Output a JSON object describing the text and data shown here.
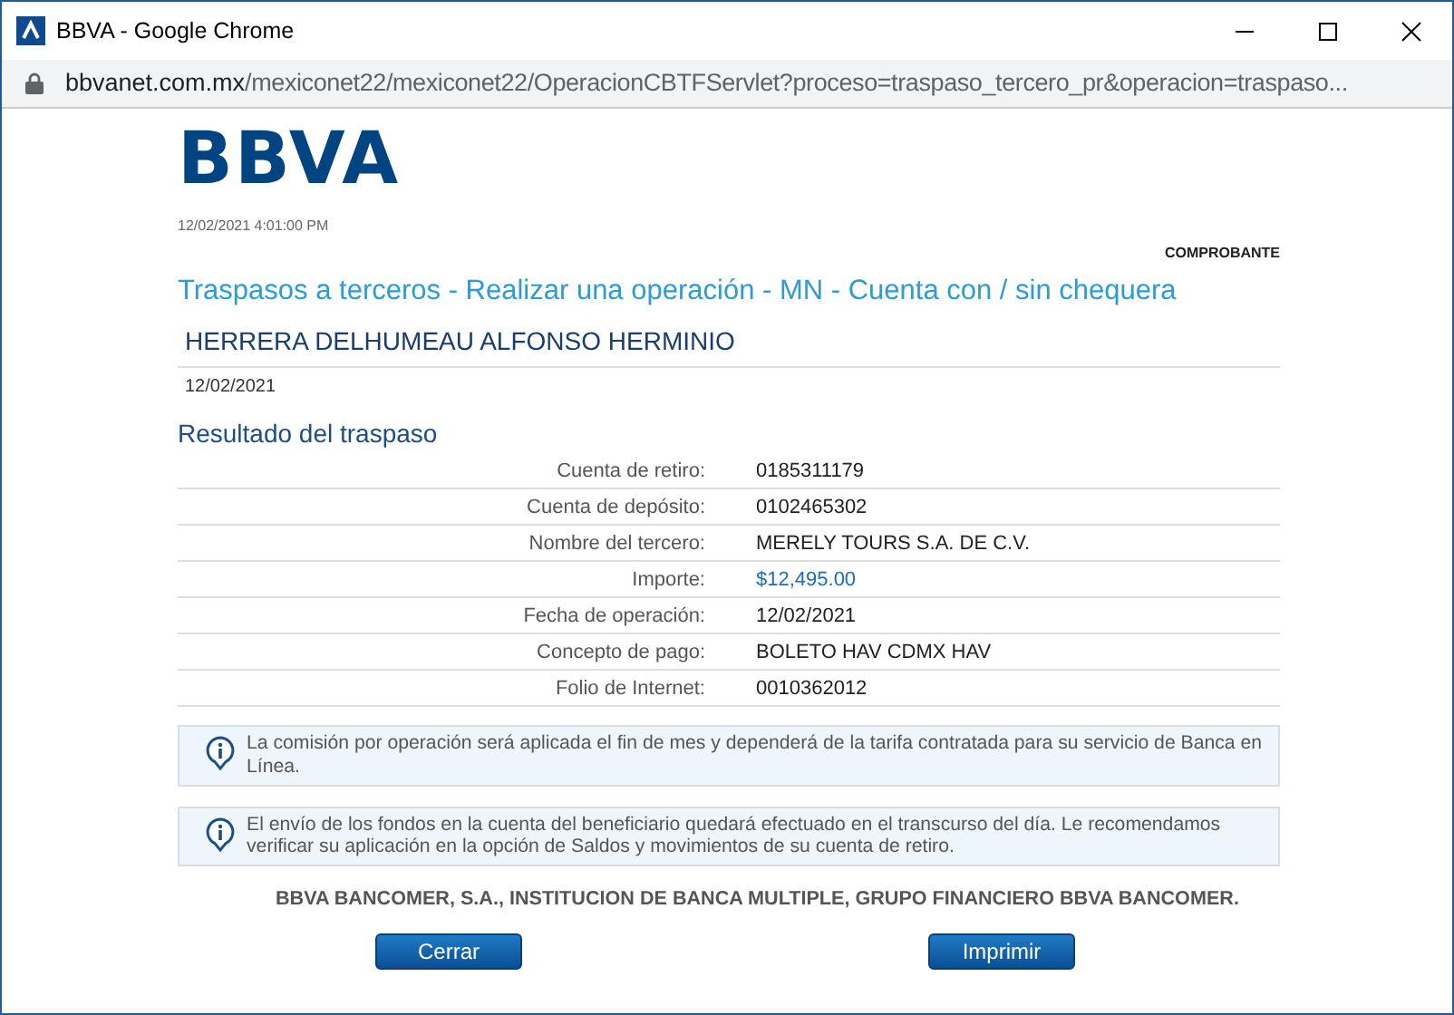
{
  "window": {
    "title": "BBVA - Google Chrome"
  },
  "address_bar": {
    "host": "bbvanet.com.mx",
    "path": "/mexiconet22/mexiconet22/OperacionCBTFServlet?proceso=traspaso_tercero_pr&operacion=traspaso..."
  },
  "logo": "BBVA",
  "timestamp": "12/02/2021 4:01:00 PM",
  "receipt_label": "COMPROBANTE",
  "page_title": "Traspasos a terceros - Realizar una operación - MN - Cuenta con / sin chequera",
  "client_name": "HERRERA DELHUMEAU ALFONSO HERMINIO",
  "date": "12/02/2021",
  "section_title": "Resultado del traspaso",
  "details": [
    {
      "label": "Cuenta de retiro:",
      "value": "0185311179",
      "kind": "plain"
    },
    {
      "label": "Cuenta de depósito:",
      "value": "0102465302",
      "kind": "plain"
    },
    {
      "label": "Nombre del tercero:",
      "value": "MERELY TOURS S.A. DE C.V.",
      "kind": "plain"
    },
    {
      "label": "Importe:",
      "value": "$12,495.00",
      "kind": "amount"
    },
    {
      "label": "Fecha de operación:",
      "value": "12/02/2021",
      "kind": "plain"
    },
    {
      "label": "Concepto de pago:",
      "value": "BOLETO HAV CDMX HAV",
      "kind": "plain"
    },
    {
      "label": "Folio de Internet:",
      "value": "0010362012",
      "kind": "plain"
    }
  ],
  "notices": [
    "La comisión por operación será aplicada el fin de mes y dependerá de la tarifa contratada para su servicio de Banca en Línea.",
    "El envío de los fondos en la cuenta del beneficiario quedará efectuado en el transcurso del día. Le recomendamos verificar su aplicación en la opción de Saldos y movimientos de su cuenta de retiro."
  ],
  "legal": "BBVA BANCOMER, S.A., INSTITUCION DE BANCA MULTIPLE, GRUPO FINANCIERO BBVA BANCOMER.",
  "buttons": [
    "Cerrar",
    "Imprimir"
  ]
}
